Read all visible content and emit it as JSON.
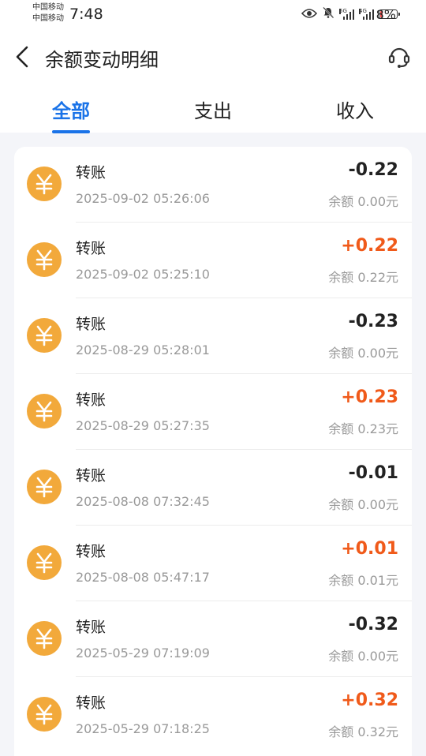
{
  "status_bar": {
    "carrier_1": "中国移动",
    "carrier_2": "中国移动",
    "time": "7:48",
    "net_1": "5G",
    "net_2": "4G",
    "battery_pct": "8%",
    "battery_level": 0.08
  },
  "header": {
    "title": "余额变动明细"
  },
  "tabs": [
    {
      "label": "全部",
      "active": true
    },
    {
      "label": "支出",
      "active": false
    },
    {
      "label": "收入",
      "active": false
    }
  ],
  "transactions": [
    {
      "title": "转账",
      "time": "2025-09-02 05:26:06",
      "amount": "-0.22",
      "balance": "余额 0.00元",
      "type": "out"
    },
    {
      "title": "转账",
      "time": "2025-09-02 05:25:10",
      "amount": "+0.22",
      "balance": "余额 0.22元",
      "type": "in"
    },
    {
      "title": "转账",
      "time": "2025-08-29 05:28:01",
      "amount": "-0.23",
      "balance": "余额 0.00元",
      "type": "out"
    },
    {
      "title": "转账",
      "time": "2025-08-29 05:27:35",
      "amount": "+0.23",
      "balance": "余额 0.23元",
      "type": "in"
    },
    {
      "title": "转账",
      "time": "2025-08-08 07:32:45",
      "amount": "-0.01",
      "balance": "余额 0.00元",
      "type": "out"
    },
    {
      "title": "转账",
      "time": "2025-08-08 05:47:17",
      "amount": "+0.01",
      "balance": "余额 0.01元",
      "type": "in"
    },
    {
      "title": "转账",
      "time": "2025-05-29 07:19:09",
      "amount": "-0.32",
      "balance": "余额 0.00元",
      "type": "out"
    },
    {
      "title": "转账",
      "time": "2025-05-29 07:18:25",
      "amount": "+0.32",
      "balance": "余额 0.32元",
      "type": "in"
    }
  ],
  "colors": {
    "accent": "#1a73e8",
    "income": "#f05a1a",
    "coin": "#f2a93b"
  },
  "icons": {
    "back": "chevron-left-icon",
    "service": "headset-icon",
    "row": "yuan-coin-icon"
  }
}
